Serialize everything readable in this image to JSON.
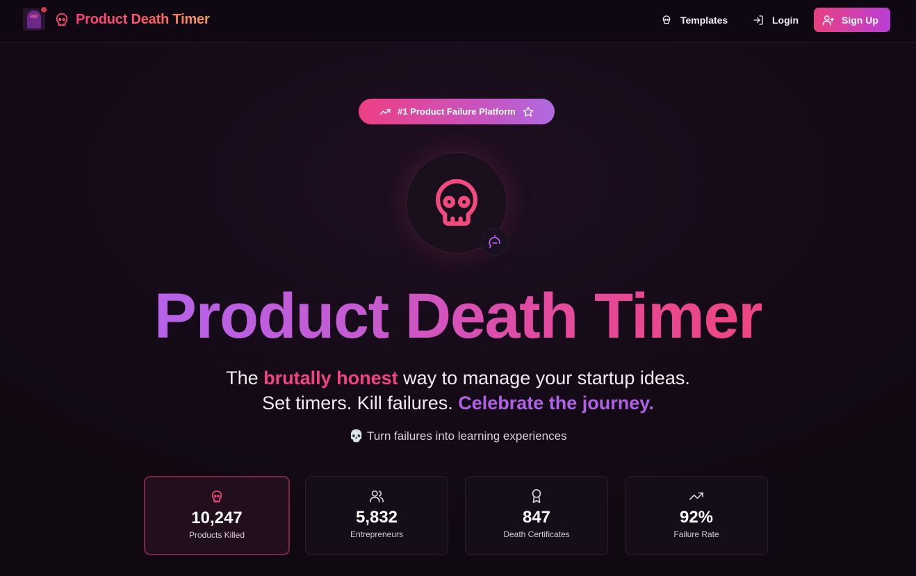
{
  "nav": {
    "logo_text": "RIP",
    "brand": "Product Death Timer",
    "links": [
      {
        "label": "Templates",
        "icon": "skull-icon"
      },
      {
        "label": "Login",
        "icon": "login-icon"
      }
    ],
    "signup_label": "Sign Up"
  },
  "badge": {
    "label": "#1 Product Failure Platform"
  },
  "hero": {
    "title": "Product Death Timer",
    "line1_pre": "The ",
    "line1_highlight": "brutally honest",
    "line1_post": " way to manage your startup ideas.",
    "line2_pre": "Set timers. Kill failures. ",
    "line2_highlight": "Celebrate the journey.",
    "tagline": "💀 Turn failures into learning experiences"
  },
  "stats": [
    {
      "value": "10,247",
      "label": "Products Killed",
      "icon": "skull-icon"
    },
    {
      "value": "5,832",
      "label": "Entrepreneurs",
      "icon": "users-icon"
    },
    {
      "value": "847",
      "label": "Death Certificates",
      "icon": "award-icon"
    },
    {
      "value": "92%",
      "label": "Failure Rate",
      "icon": "trending-up-icon"
    }
  ],
  "colors": {
    "accent_pink": "#f0437f",
    "accent_purple": "#b161e6",
    "background": "#130a16"
  }
}
